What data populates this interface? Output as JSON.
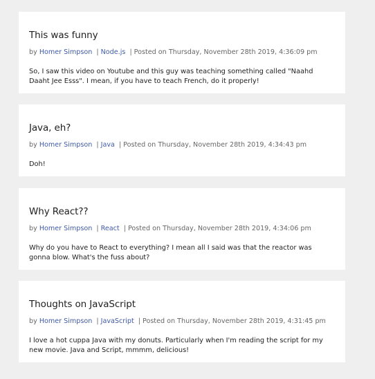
{
  "posts": [
    {
      "title": "This was funny",
      "by_label": "by",
      "author": "Homer Simpson",
      "category": "Node.js",
      "posted_label": "Posted on",
      "date": "Thursday, November 28th 2019, 4:36:09 pm",
      "body": "So, I saw this video on Youtube and this guy was teaching something called \"Naahd Daaht Jee Esss\". I mean, if you have to teach French, do it properly!"
    },
    {
      "title": "Java, eh?",
      "by_label": "by",
      "author": "Homer Simpson",
      "category": "Java",
      "posted_label": "Posted on",
      "date": "Thursday, November 28th 2019, 4:34:43 pm",
      "body": "Doh!"
    },
    {
      "title": "Why React??",
      "by_label": "by",
      "author": "Homer Simpson",
      "category": "React",
      "posted_label": "Posted on",
      "date": "Thursday, November 28th 2019, 4:34:06 pm",
      "body": "Why do you have to React to everything? I mean all I said was that the reactor was gonna blow. What's the fuss about?"
    },
    {
      "title": "Thoughts on JavaScript",
      "by_label": "by",
      "author": "Homer Simpson",
      "category": "JavaScript",
      "posted_label": "Posted on",
      "date": "Thursday, November 28th 2019, 4:31:45 pm",
      "body": "I love a hot cuppa Java with my donuts. Particularly when I'm reading the script for my new movie. Java and Script, mmmm, delicious!"
    }
  ],
  "colors": {
    "background": "#efefef",
    "card": "#ffffff",
    "link": "#3f5aa6",
    "meta": "#666666",
    "text": "#222222"
  }
}
